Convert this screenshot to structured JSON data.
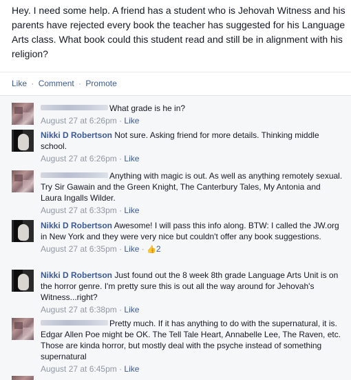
{
  "post": {
    "text": "Hey. I need some help. A friend has a student who is Jehovah Witness and his parents have rejected every book the teacher has suggested for his Language Arts class. What book could this student read and still be in alignment with his religion?"
  },
  "actions": {
    "like": "Like",
    "comment": "Comment",
    "promote": "Promote",
    "separator": "·"
  },
  "comments": [
    {
      "author": "",
      "text": "What grade is he in?",
      "time": "August 27 at 6:26pm",
      "like": "Like",
      "likes": ""
    },
    {
      "author": "Nikki D Robertson",
      "text": "Not sure. Asking friend for more details. Thinking middle school.",
      "time": "August 27 at 6:26pm",
      "like": "Like",
      "likes": ""
    },
    {
      "author": "",
      "text": "Anything with magic is out. As well as anything remotely sexual. Try Sir Gawain and the Green Knight, The Canterbury Tales, My Antonia and Laura Ingalls Wilder.",
      "time": "August 27 at 6:33pm",
      "like": "Like",
      "likes": ""
    },
    {
      "author": "Nikki D Robertson",
      "text": "Awesome! I will pass this info along. BTW: I called the JW.org in New York and they were very nice but couldn't offer any book suggestions.",
      "time": "August 27 at 6:35pm",
      "like": "Like",
      "likes": "2"
    },
    {
      "author": "Nikki D Robertson",
      "text": "Just found out the 8 week 8th grade Language Arts Unit is on the horror genre. I'm pretty sure this is out all the way around for Jehovah's Witness...right?",
      "time": "August 27 at 6:38pm",
      "like": "Like",
      "likes": ""
    },
    {
      "author": "",
      "text": "Pretty much. If it has anything to do with the supernatural, it is. Edgar Allen Poe might be OK. The Tell Tale Heart, Annabelle Lee, The Raven, etc. Those are kinda horror, but mostly deal with the psyche instead of something supernatural",
      "time": "August 27 at 6:45pm",
      "like": "Like",
      "likes": ""
    }
  ]
}
